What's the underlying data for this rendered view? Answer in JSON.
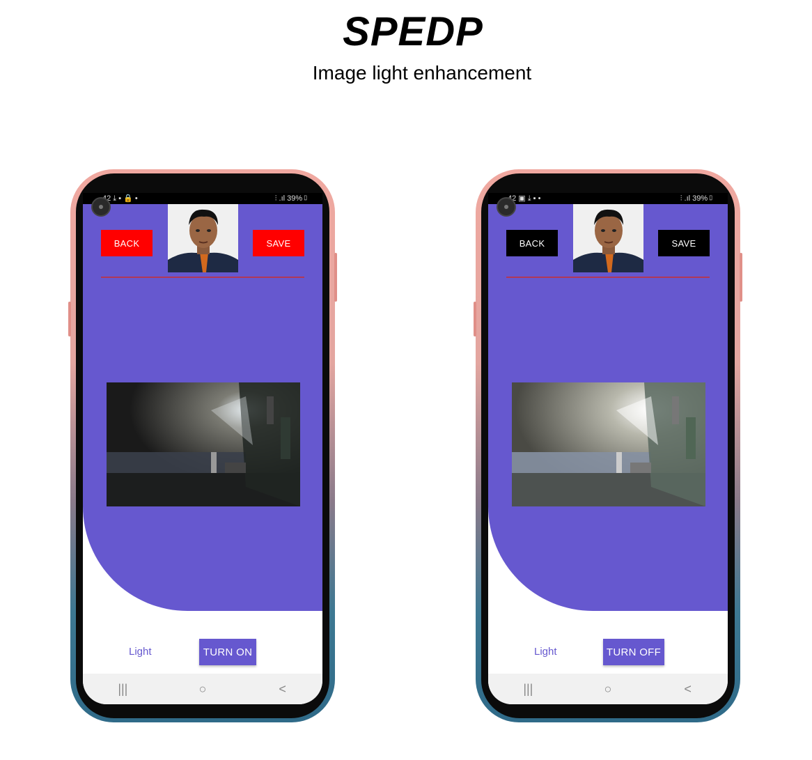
{
  "header": {
    "title": "SPEDP",
    "subtitle": "Image light enhancement"
  },
  "phones": [
    {
      "status_left": "42 ⤓ ▪ 🔒 •",
      "status_right": "⫶ .ıl 39%▯",
      "back_label": "BACK",
      "save_label": "SAVE",
      "button_color": "#ff0000",
      "light_label": "Light",
      "toggle_label": "TURN ON",
      "light_state": "off",
      "nav": {
        "recents": "|||",
        "home": "○",
        "back": "<"
      }
    },
    {
      "status_left": "42 ▣ ⤓ ▪ •",
      "status_right": "⫶ .ıl 39%▯",
      "back_label": "BACK",
      "save_label": "SAVE",
      "button_color": "#000000",
      "light_label": "Light",
      "toggle_label": "TURN OFF",
      "light_state": "on",
      "nav": {
        "recents": "|||",
        "home": "○",
        "back": "<"
      }
    }
  ],
  "colors": {
    "accent_purple": "#6658cf",
    "divider": "#b03858"
  }
}
